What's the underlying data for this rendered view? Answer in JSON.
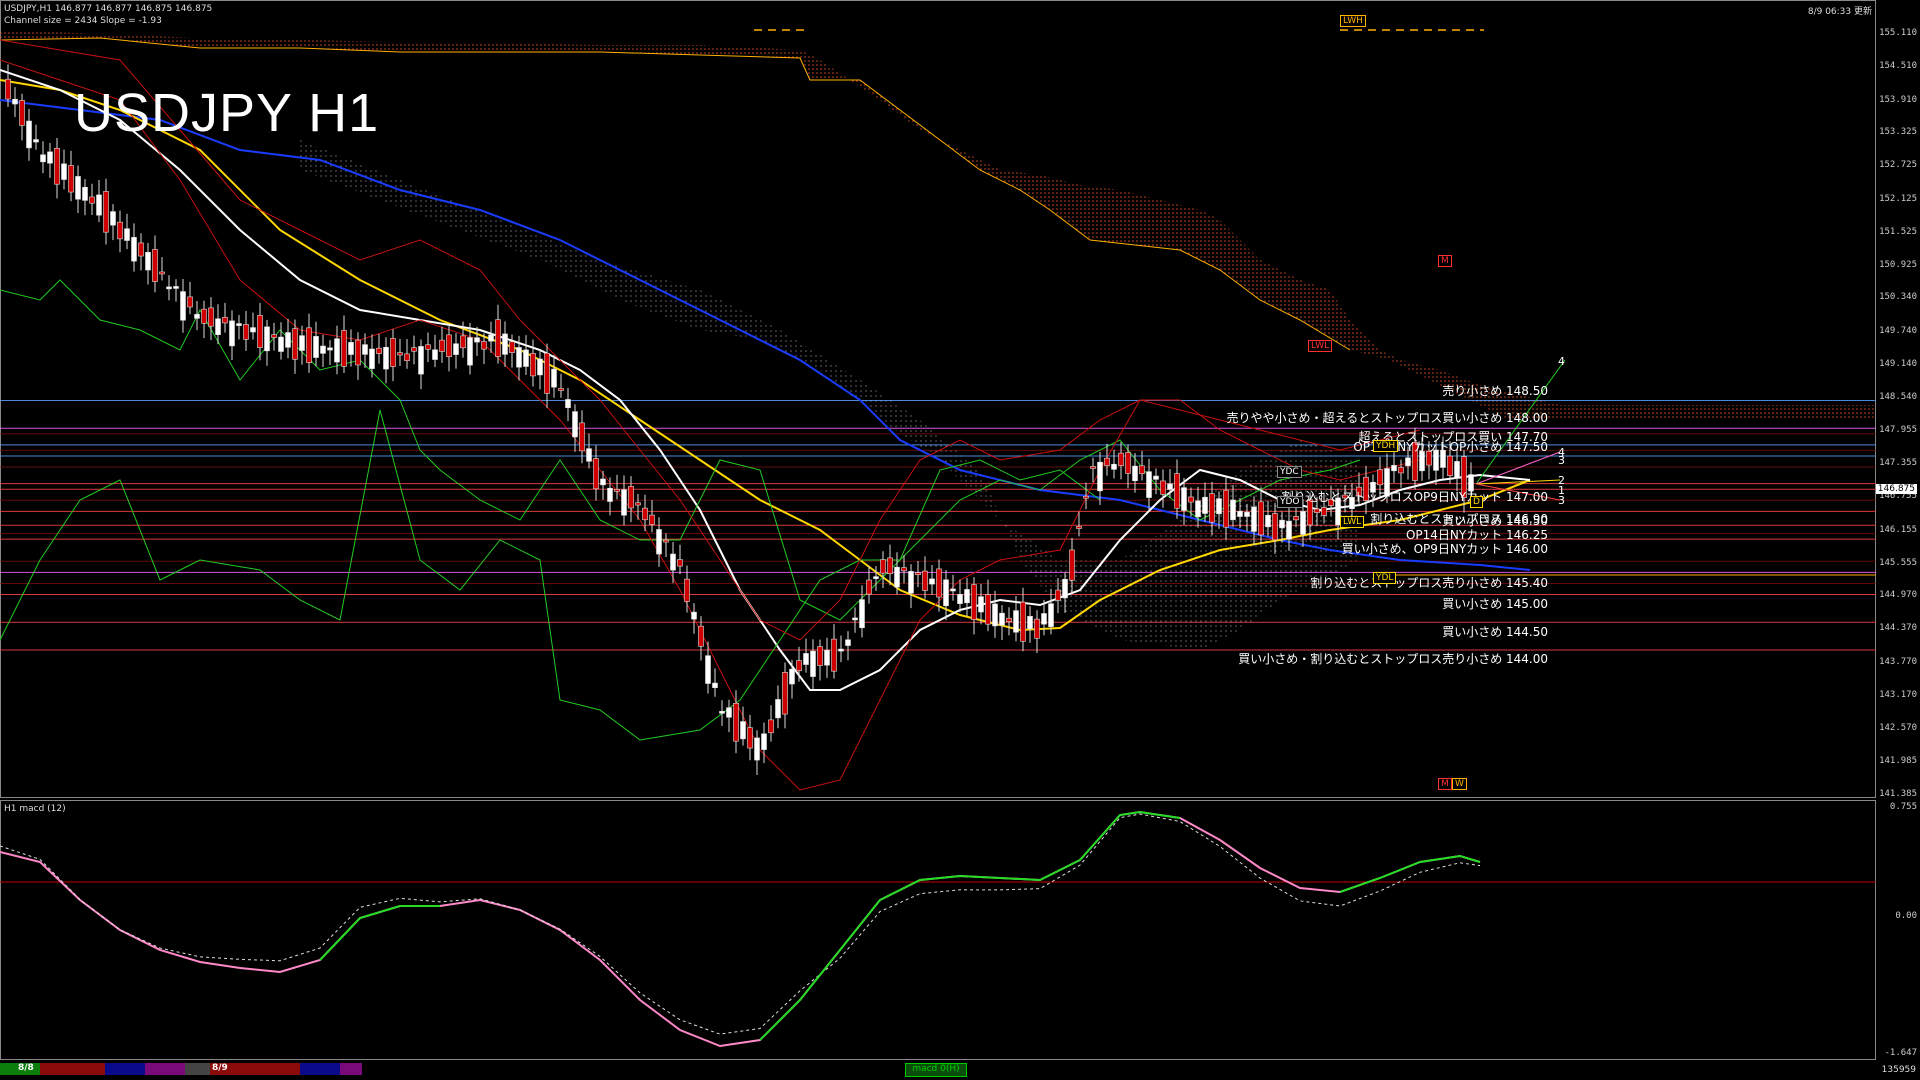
{
  "header": {
    "symbol_line": "USDJPY,H1  146.877 146.877 146.875 146.875",
    "channel_line": "Channel size = 2434 Slope = -1.93",
    "timestamp": "8/9 06:33 更新"
  },
  "watermark_title": "USDJPY H1",
  "price_axis": [
    "155.110",
    "154.510",
    "153.910",
    "153.325",
    "152.725",
    "152.125",
    "151.525",
    "150.925",
    "150.340",
    "149.740",
    "149.140",
    "148.540",
    "147.955",
    "147.355",
    "146.755",
    "146.155",
    "145.555",
    "144.970",
    "144.370",
    "143.770",
    "143.170",
    "142.570",
    "141.985",
    "141.385"
  ],
  "current_price": "146.875",
  "levels": [
    {
      "text": "売り小さめ 148.50",
      "color": "#5aa0ff"
    },
    {
      "text": "売りやや小さめ・超えるとストップロス買い小さめ 148.00",
      "color": "#ff66ff"
    },
    {
      "text": "超えるとストップロス買い 147.70",
      "color": "#5aa0ff"
    },
    {
      "text": "OP14日NYカットOP小さめ 147.50",
      "color": "#5aa0ff"
    },
    {
      "text": "割り込むとストップロスOP9日NYカット 147.00",
      "color": "#ff4444"
    },
    {
      "text": "割り込むとストップロス 146.90",
      "color": "#ff4444"
    },
    {
      "text": "買い小さめ 146.50",
      "color": "#ff4444"
    },
    {
      "text": "OP14日NYカット 146.25",
      "color": "#ff4444"
    },
    {
      "text": "買い小さめ、OP9日NYカット 146.00",
      "color": "#ff4444"
    },
    {
      "text": "割り込むとストップロス売り小さめ 145.40",
      "color": "#ff66ff"
    },
    {
      "text": "買い小さめ 145.00",
      "color": "#ff4444"
    },
    {
      "text": "買い小さめ 144.50",
      "color": "#ff4444"
    },
    {
      "text": "買い小さめ・割り込むとストップロス売り小さめ 144.00",
      "color": "#ff4444"
    }
  ],
  "tags": {
    "lwh": "LWH",
    "lwl": "LWL",
    "m1": "M",
    "m2": "M",
    "w": "W",
    "ydh": "YDH",
    "ydc1": "YDC",
    "ydc2": "YDO",
    "ydl": "YDL",
    "lwl2": "LWL",
    "d": "D"
  },
  "proj_numbers": [
    "4",
    "4",
    "3",
    "2",
    "1",
    "3"
  ],
  "macd": {
    "title": "H1  macd (12)",
    "axis": [
      "0.755",
      "0.00",
      "-1.647"
    ]
  },
  "timebar": {
    "d1": "8/8",
    "d2": "8/9",
    "right": "135959",
    "mid": "macd 0(H)"
  },
  "colors": {
    "cloud": "#c84a1a",
    "white_ma": "#ffffff",
    "yellow_ma": "#ffd700",
    "blue_ma": "#1a3cff",
    "green": "#22cc22",
    "band": "#c81010"
  }
}
